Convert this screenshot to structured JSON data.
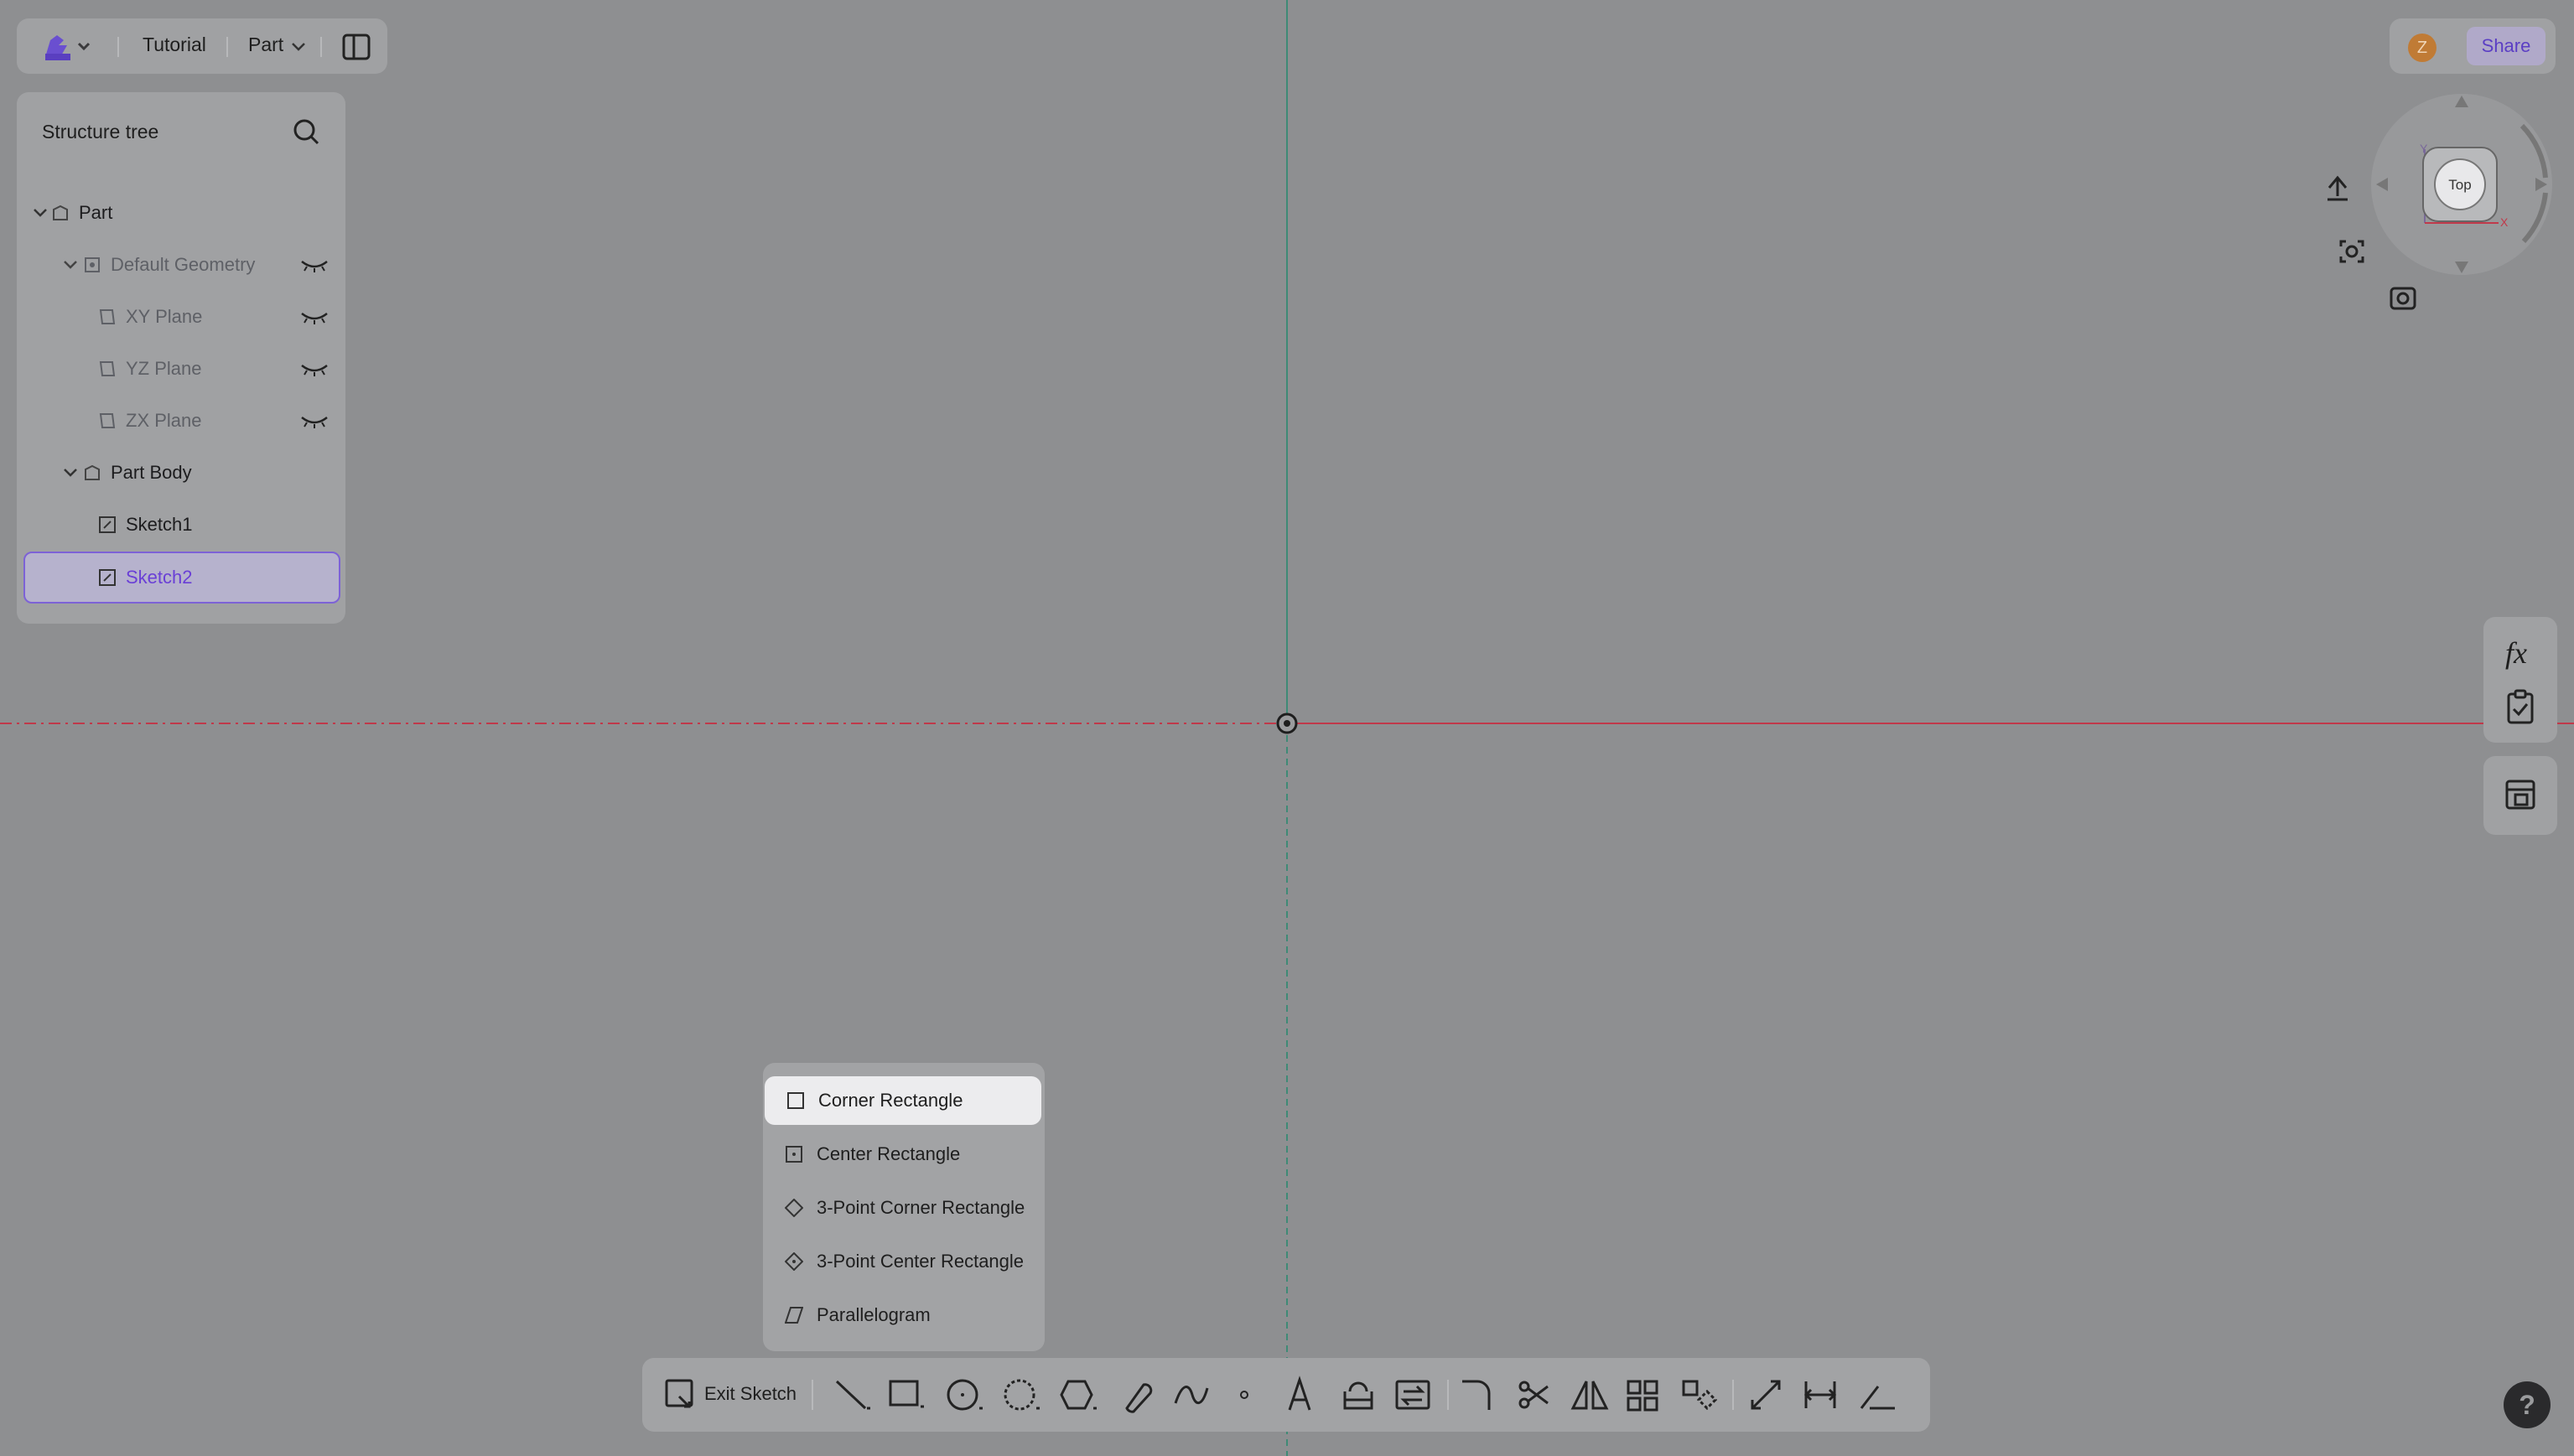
{
  "header": {
    "app_menu_icon": "app-logo-icon",
    "breadcrumb_document": "Tutorial",
    "breadcrumb_workspace": "Part",
    "layout_toggle_icon": "panel-layout-icon"
  },
  "tree": {
    "title": "Structure tree",
    "items": [
      {
        "label": "Part"
      },
      {
        "label": "Default Geometry"
      },
      {
        "label": "XY Plane"
      },
      {
        "label": "YZ Plane"
      },
      {
        "label": "ZX Plane"
      },
      {
        "label": "Part Body"
      },
      {
        "label": "Sketch1"
      },
      {
        "label": "Sketch2"
      }
    ]
  },
  "user": {
    "avatar_initial": "Z",
    "share_label": "Share"
  },
  "view_cube": {
    "face_label": "Top",
    "axis_x": "X",
    "axis_y": "Y"
  },
  "rectangle_menu": {
    "items": [
      {
        "label": "Corner Rectangle",
        "icon": "corner-rectangle-icon"
      },
      {
        "label": "Center Rectangle",
        "icon": "center-rectangle-icon"
      },
      {
        "label": "3-Point Corner Rectangle",
        "icon": "3-point-corner-rectangle-icon"
      },
      {
        "label": "3-Point Center Rectangle",
        "icon": "3-point-center-rectangle-icon"
      },
      {
        "label": "Parallelogram",
        "icon": "parallelogram-icon"
      }
    ]
  },
  "toolbar": {
    "exit_label": "Exit Sketch"
  },
  "right_panel": {
    "formula_glyph": "fx"
  },
  "help": {
    "label": "?"
  },
  "colors": {
    "canvas": "#8e8f91",
    "panel": "#a0a1a3",
    "accent": "#6a3fd6",
    "x_axis": "#c0394a",
    "y_axis": "#3a8a76"
  }
}
